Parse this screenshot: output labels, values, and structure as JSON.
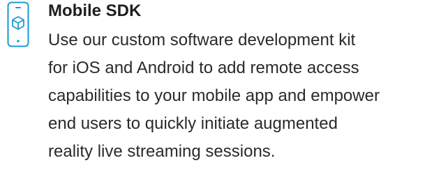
{
  "feature": {
    "icon": "mobile-cube-icon",
    "accent_color": "#1a9ad6",
    "title": "Mobile SDK",
    "description_lines": [
      "Use our custom software development kit",
      "for iOS and Android to add remote access",
      "capabilities to your mobile app and empower",
      "end users to quickly initiate augmented",
      "reality live streaming sessions."
    ]
  }
}
